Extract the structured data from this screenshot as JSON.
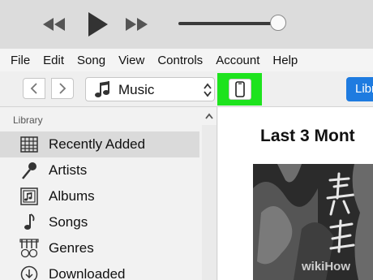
{
  "transport": {
    "volume_level": 0.96
  },
  "menu": {
    "items": [
      "File",
      "Edit",
      "Song",
      "View",
      "Controls",
      "Account",
      "Help"
    ]
  },
  "toolbar": {
    "media_type": "Music",
    "library_button": "Libr",
    "device_highlight_color": "#1de31d",
    "accent_color": "#1e7be0"
  },
  "sidebar": {
    "header": "Library",
    "items": [
      {
        "label": "Recently Added",
        "icon": "grid-icon",
        "active": true
      },
      {
        "label": "Artists",
        "icon": "microphone-icon",
        "active": false
      },
      {
        "label": "Albums",
        "icon": "album-icon",
        "active": false
      },
      {
        "label": "Songs",
        "icon": "music-note-icon",
        "active": false
      },
      {
        "label": "Genres",
        "icon": "genres-icon",
        "active": false
      },
      {
        "label": "Downloaded",
        "icon": "download-icon",
        "active": false
      }
    ]
  },
  "main": {
    "title": "Last 3 Mont"
  },
  "watermark": "wikiHow"
}
